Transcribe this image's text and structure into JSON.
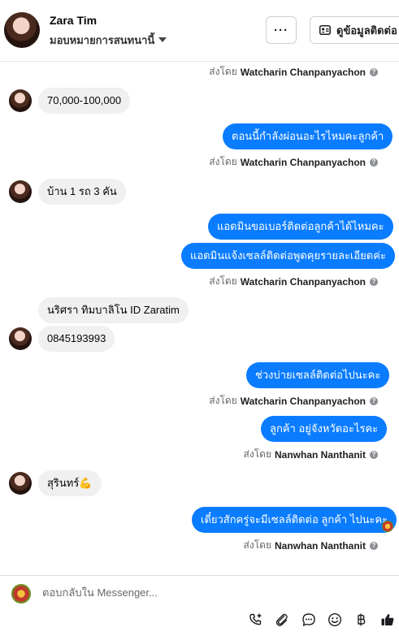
{
  "header": {
    "contact_name": "Zara Tim",
    "assign_label": "มอบหมายการสนทนานี้",
    "more_label": "···",
    "contact_info_label": "ดูข้อมูลติดต่อ"
  },
  "messages": {
    "sent_prefix": "ส่งโดย",
    "top_sender": "Watcharin Chanpanyachon",
    "m1": "70,000-100,000",
    "m2": "ตอนนี้กำลังผ่อนอะไรไหมคะลูกค้า",
    "m2_sender": "Watcharin Chanpanyachon",
    "m3": "บ้าน 1 รถ 3 คัน",
    "m4": "แอดมินขอเบอร์ติดต่อลูกค้าได้ไหมคะ",
    "m5": "แอดมินแจ้งเซลล์ติดต่อพูดคุยรายละเอียดค่ะ",
    "m5_sender": "Watcharin Chanpanyachon",
    "m6": "นริศรา ทิมบาลิโน ID Zaratim",
    "m7": "0845193993",
    "m8": "ช่วงบ่ายเซลล์ติดต่อไปนะคะ",
    "m8_sender": "Watcharin Chanpanyachon",
    "m9": "ลูกค้า  อยู่จังหวัดอะไรคะ",
    "m9_sender": "Nanwhan Nanthanit",
    "m10": "สุรินทร์💪",
    "m11": "เดี๋ยวสักครู่จะมีเซลล์ติดต่อ ลูกค้า ไปนะคะ",
    "m11_sender": "Nanwhan Nanthanit",
    "info_glyph": "?"
  },
  "composer": {
    "placeholder": "ตอบกลับใน Messenger...",
    "value": ""
  },
  "colors": {
    "outgoing_bubble": "#0a7cff",
    "incoming_bubble": "#f0f0f0",
    "accent_blue": "#0a7cff"
  },
  "icons": [
    "more-icon",
    "contact-card-icon",
    "add-call-icon",
    "paperclip-icon",
    "saved-reply-icon",
    "emoji-icon",
    "baht-icon",
    "thumbs-up-icon"
  ]
}
